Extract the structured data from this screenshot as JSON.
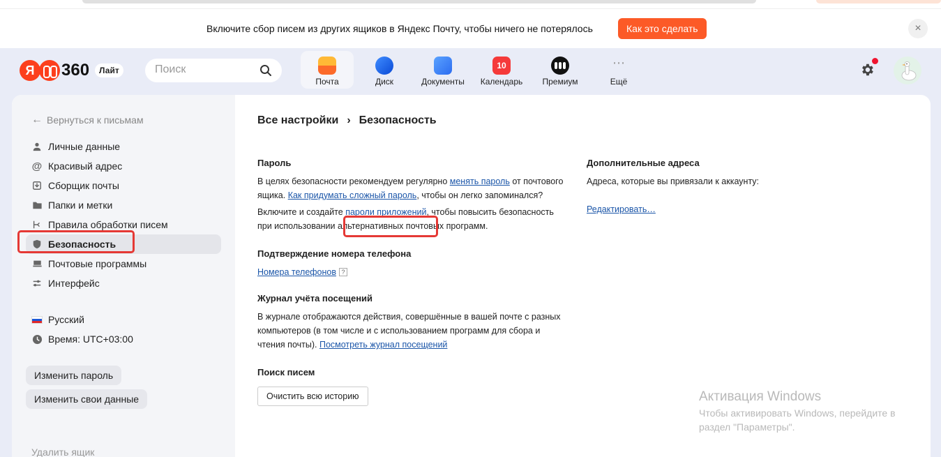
{
  "banner": {
    "text": "Включите сбор писем из других ящиков в Яндекс Почту, чтобы ничего не потерялось",
    "button": "Как это сделать",
    "close": "×"
  },
  "header": {
    "logo_ya": "Я",
    "logo_num": "360",
    "logo_badge": "Лайт",
    "search_placeholder": "Поиск",
    "apps": [
      {
        "label": "Почта",
        "icon": "mail-icon"
      },
      {
        "label": "Диск",
        "icon": "disk-icon"
      },
      {
        "label": "Документы",
        "icon": "docs-icon"
      },
      {
        "label": "Календарь",
        "icon": "calendar-icon",
        "badge": "10"
      },
      {
        "label": "Премиум",
        "icon": "premium-icon"
      },
      {
        "label": "Ещё",
        "icon": "more-icon",
        "glyph": "⋯"
      }
    ]
  },
  "sidebar": {
    "back": "Вернуться к письмам",
    "items": [
      {
        "label": "Личные данные",
        "icon": "person-icon"
      },
      {
        "label": "Красивый адрес",
        "icon": "at-icon"
      },
      {
        "label": "Сборщик почты",
        "icon": "collector-icon"
      },
      {
        "label": "Папки и метки",
        "icon": "folder-icon"
      },
      {
        "label": "Правила обработки писем",
        "icon": "rules-icon"
      },
      {
        "label": "Безопасность",
        "icon": "shield-icon",
        "active": true
      },
      {
        "label": "Почтовые программы",
        "icon": "mail-programs-icon"
      },
      {
        "label": "Интерфейс",
        "icon": "sliders-icon"
      }
    ],
    "language": "Русский",
    "timezone": "Время: UTC+03:00",
    "change_password": "Изменить пароль",
    "change_data": "Изменить свои данные",
    "delete_box": "Удалить ящик"
  },
  "content": {
    "breadcrumb_root": "Все настройки",
    "breadcrumb_sep": "›",
    "breadcrumb_current": "Безопасность",
    "password": {
      "title": "Пароль",
      "p1_a": "В целях безопасности рекомендуем регулярно ",
      "p1_link1": "менять пароль",
      "p1_b": " от почтового ящика. ",
      "p1_link2": "Как придумать сложный пароль",
      "p1_c": ", чтобы он легко запоминался?",
      "p2_a": "Включите и создайте ",
      "p2_link": "пароли приложений",
      "p2_b": ", чтобы повысить безопасность при использовании альтернативных почтовых программ."
    },
    "phone": {
      "title": "Подтверждение номера телефона",
      "link": "Номера телефонов",
      "help": "?"
    },
    "journal": {
      "title": "Журнал учёта посещений",
      "text": "В журнале отображаются действия, совершённые в вашей почте с разных компьютеров (в том числе и с использованием программ для сбора и чтения почты). ",
      "link": "Посмотреть журнал посещений"
    },
    "search": {
      "title": "Поиск писем",
      "button": "Очистить всю историю"
    },
    "extra": {
      "title": "Дополнительные адреса",
      "text": "Адреса, которые вы привязали к аккаунту:",
      "link": "Редактировать…"
    }
  },
  "watermark": {
    "title": "Активация Windows",
    "text": "Чтобы активировать Windows, перейдите в раздел \"Параметры\"."
  }
}
